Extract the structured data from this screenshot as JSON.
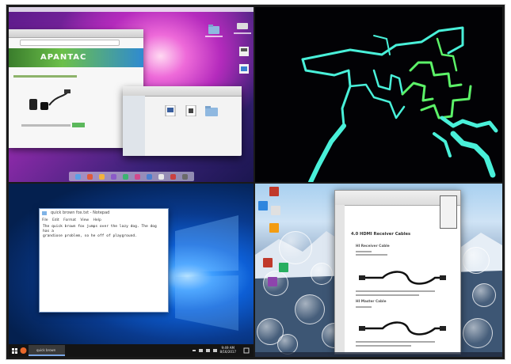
{
  "win10": {
    "notepad": {
      "title": "quick brown fox.txt - Notepad",
      "menu": [
        "File",
        "Edit",
        "Format",
        "View",
        "Help"
      ],
      "text": [
        "The quick brown fox jumps over the lazy dog. The dog has a",
        "grandiose problem, so he off of playground."
      ]
    },
    "taskbar": {
      "task_label": "quick brown fox.txt...",
      "time": "9:49 AM",
      "date": "8/16/2017"
    }
  },
  "win8": {
    "pdf": {
      "heading": "4.0 HDMI Receiver Cables",
      "section1": "HI Receiver Cable",
      "section2": "HI Master Cable"
    }
  },
  "mac": {
    "site_logo": "APANTAC"
  },
  "colors": {
    "pipe_cyan": "#49f0d9",
    "pipe_green": "#5cf268",
    "taskbar": "#141414",
    "mac_accent": "#b52bbd"
  }
}
